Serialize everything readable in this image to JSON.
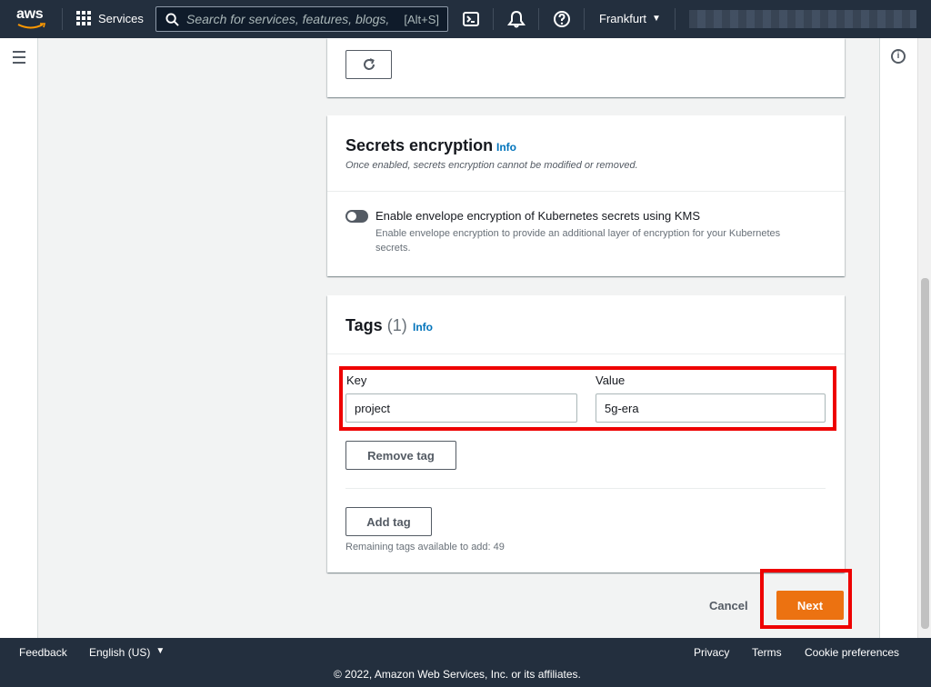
{
  "topnav": {
    "logo_text": "aws",
    "services_label": "Services",
    "search_placeholder": "Search for services, features, blogs,",
    "search_shortcut": "[Alt+S]",
    "region_label": "Frankfurt"
  },
  "refresh_panel": {},
  "secrets_encryption": {
    "title": "Secrets encryption",
    "info": "Info",
    "description": "Once enabled, secrets encryption cannot be modified or removed.",
    "toggle_label": "Enable envelope encryption of Kubernetes secrets using KMS",
    "toggle_description": "Enable envelope encryption to provide an additional layer of encryption for your Kubernetes secrets.",
    "enabled": false
  },
  "tags": {
    "title": "Tags",
    "count": "(1)",
    "info": "Info",
    "key_label": "Key",
    "value_label": "Value",
    "items": [
      {
        "key": "project",
        "value": "5g-era"
      }
    ],
    "remove_label": "Remove tag",
    "add_label": "Add tag",
    "remaining_text": "Remaining tags available to add: 49"
  },
  "actions": {
    "cancel_label": "Cancel",
    "next_label": "Next"
  },
  "footer": {
    "feedback": "Feedback",
    "language": "English (US)",
    "privacy": "Privacy",
    "terms": "Terms",
    "cookie": "Cookie preferences",
    "copyright": "© 2022, Amazon Web Services, Inc. or its affiliates."
  },
  "colors": {
    "nav_bg": "#232f3e",
    "primary_button": "#ec7211",
    "link": "#0073bb",
    "highlight": "#ee0000"
  }
}
